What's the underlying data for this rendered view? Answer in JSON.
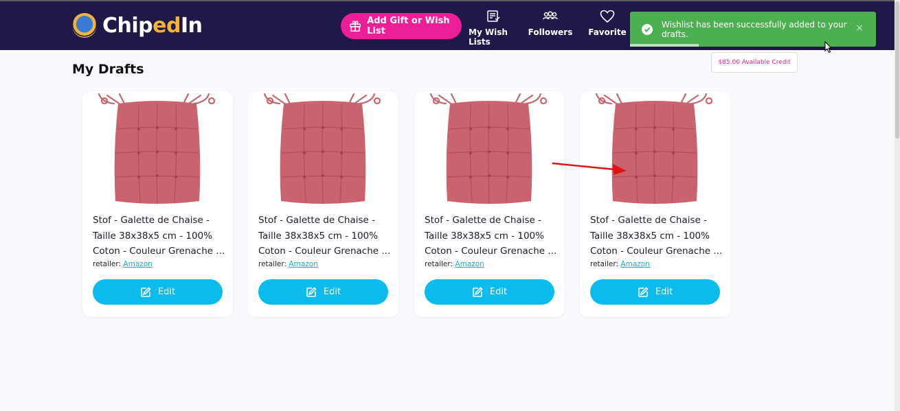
{
  "header": {
    "logo_text_a": "Chip",
    "logo_text_b": "ed",
    "logo_text_c": "In",
    "add_button_label": "Add Gift or Wish List",
    "nav": [
      {
        "label": "My Wish Lists",
        "icon": "wishlist-icon"
      },
      {
        "label": "Followers",
        "icon": "followers-icon"
      },
      {
        "label": "Favorite",
        "icon": "heart-icon"
      }
    ]
  },
  "toast": {
    "message": "Wishlist has been successfully added to your drafts.",
    "close_label": "×",
    "progress": 0.28
  },
  "credit": {
    "label": "$85.00 Available Credit"
  },
  "main": {
    "title": "My Drafts",
    "cards": [
      {
        "title": "Stof - Galette de Chaise - Taille 38x38x5 cm - 100% Coton - Couleur Grenache ...",
        "retailer_label": "retailer:",
        "retailer": "Amazon",
        "edit_label": "Edit"
      },
      {
        "title": "Stof - Galette de Chaise - Taille 38x38x5 cm - 100% Coton - Couleur Grenache ...",
        "retailer_label": "retailer:",
        "retailer": "Amazon",
        "edit_label": "Edit"
      },
      {
        "title": "Stof - Galette de Chaise - Taille 38x38x5 cm - 100% Coton - Couleur Grenache ...",
        "retailer_label": "retailer:",
        "retailer": "Amazon",
        "edit_label": "Edit"
      },
      {
        "title": "Stof - Galette de Chaise - Taille 38x38x5 cm - 100% Coton - Couleur Grenache ...",
        "retailer_label": "retailer:",
        "retailer": "Amazon",
        "edit_label": "Edit"
      }
    ]
  },
  "colors": {
    "header_bg": "#1f1848",
    "accent_pink": "#ec1f98",
    "edit_blue": "#0bbbee",
    "toast_green": "#4caf50",
    "cushion": "#c9646f"
  }
}
